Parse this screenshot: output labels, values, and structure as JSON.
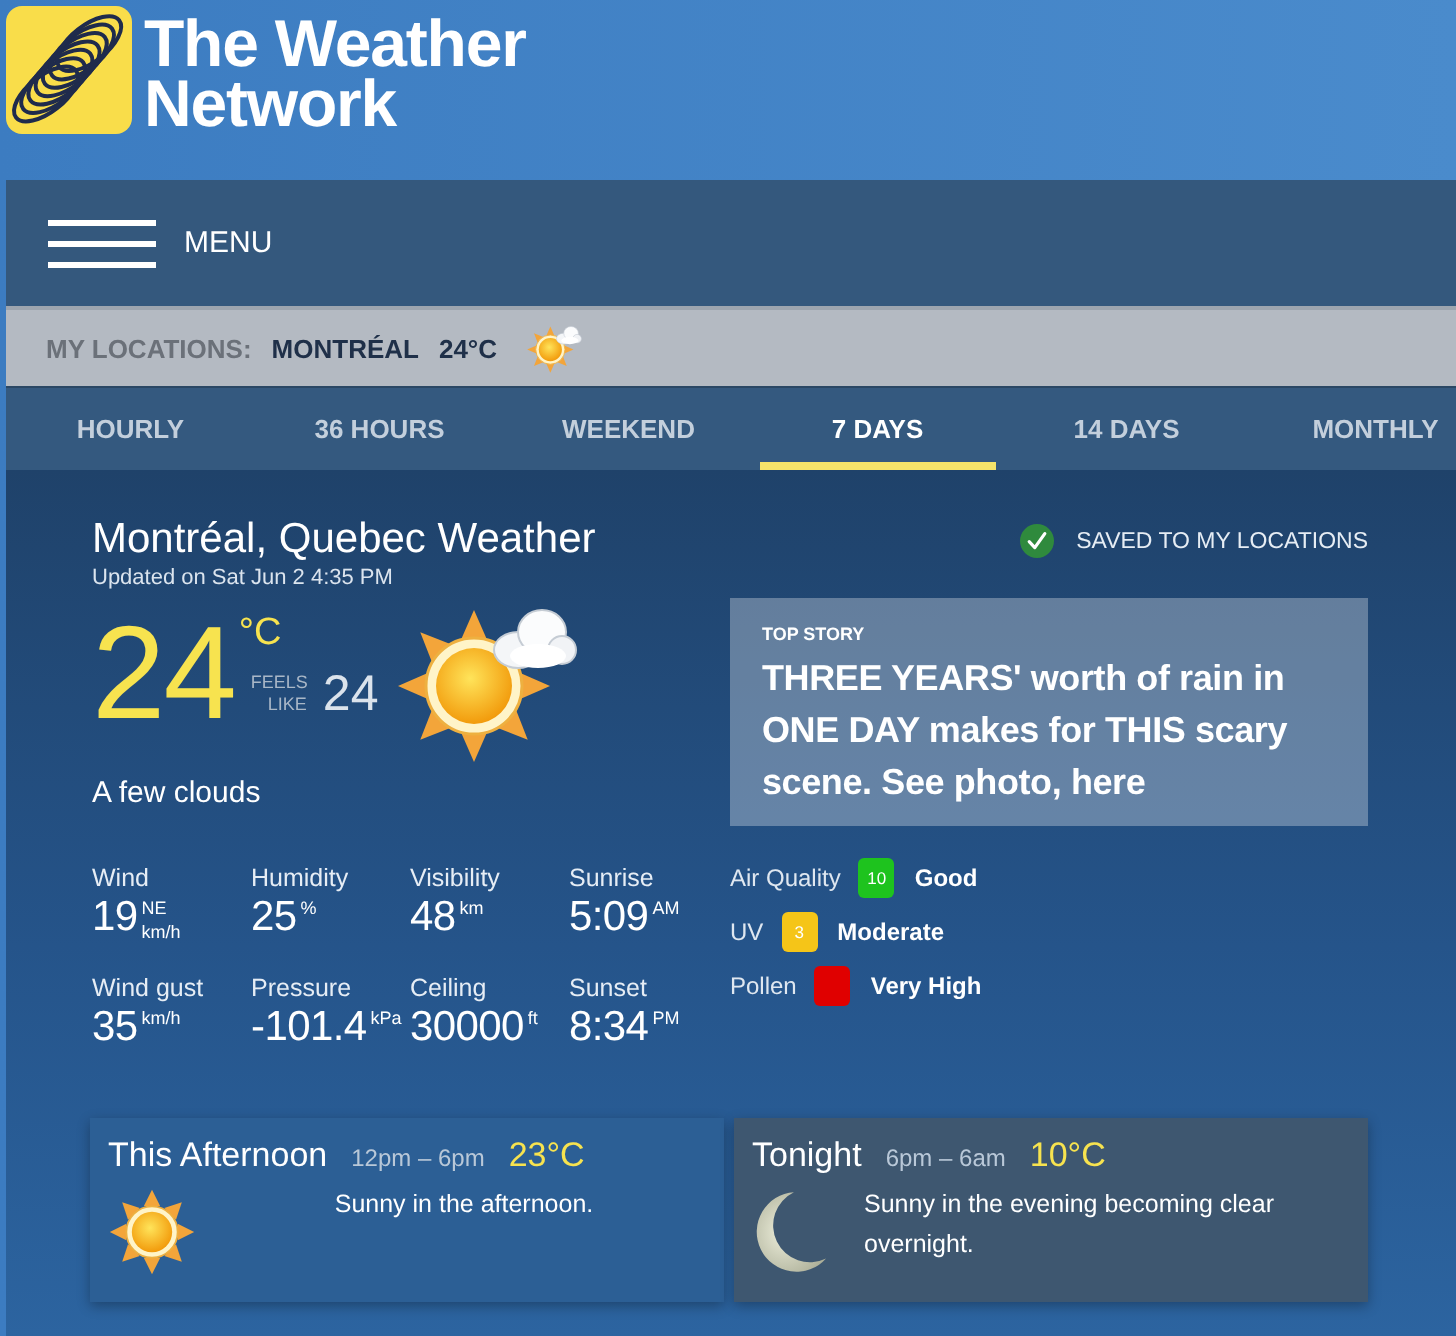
{
  "brand": {
    "lines": [
      "The Weather",
      "Network"
    ]
  },
  "menu": {
    "label": "MENU"
  },
  "my_locations": {
    "label": "MY LOCATIONS:",
    "city": "MONTRÉAL",
    "temperature": "24°C"
  },
  "tabs": [
    {
      "label": "HOURLY",
      "selected": false
    },
    {
      "label": "36 HOURS",
      "selected": false
    },
    {
      "label": "WEEKEND",
      "selected": false
    },
    {
      "label": "7 DAYS",
      "selected": true
    },
    {
      "label": "14 DAYS",
      "selected": false
    },
    {
      "label": "MONTHLY",
      "selected": false
    }
  ],
  "current": {
    "title": "Montréal, Quebec Weather",
    "updated": "Updated on Sat Jun 2 4:35 PM",
    "temperature": "24",
    "unit": "°C",
    "feels_like_label": "FEELS LIKE",
    "feels_like": "24",
    "condition": "A few clouds"
  },
  "stats": [
    {
      "label": "Wind",
      "value": "19",
      "unit_top": "NE",
      "unit_bottom": "km/h"
    },
    {
      "label": "Humidity",
      "value": "25",
      "unit_top": "%"
    },
    {
      "label": "Visibility",
      "value": "48",
      "unit_top": "km"
    },
    {
      "label": "Sunrise",
      "value": "5:09",
      "unit_top": "AM"
    },
    {
      "label": "Wind gust",
      "value": "35",
      "unit_top": "km/h"
    },
    {
      "label": "Pressure",
      "value": "-101.4",
      "unit_top": "kPa"
    },
    {
      "label": "Ceiling",
      "value": "30000",
      "unit_top": "ft"
    },
    {
      "label": "Sunset",
      "value": "8:34",
      "unit_top": "PM"
    }
  ],
  "saved": {
    "label": "SAVED TO MY LOCATIONS"
  },
  "top_story": {
    "tag": "TOP STORY",
    "headline": "THREE YEARS' worth of rain in ONE DAY makes for THIS scary scene. See photo, here"
  },
  "indices": [
    {
      "label": "Air Quality",
      "badge": "10",
      "color": "#1ec31e",
      "rating": "Good"
    },
    {
      "label": "UV",
      "badge": "3",
      "color": "#f5c518",
      "rating": "Moderate"
    },
    {
      "label": "Pollen",
      "color": "#e00000",
      "rating": "Very High"
    }
  ],
  "periods": [
    {
      "kind": "day",
      "name": "This Afternoon",
      "time": "12pm – 6pm",
      "temperature": "23°C",
      "description": "Sunny in the afternoon."
    },
    {
      "kind": "night",
      "name": "Tonight",
      "time": "6pm – 6am",
      "temperature": "10°C",
      "description": "Sunny in the evening becoming clear overnight."
    }
  ]
}
